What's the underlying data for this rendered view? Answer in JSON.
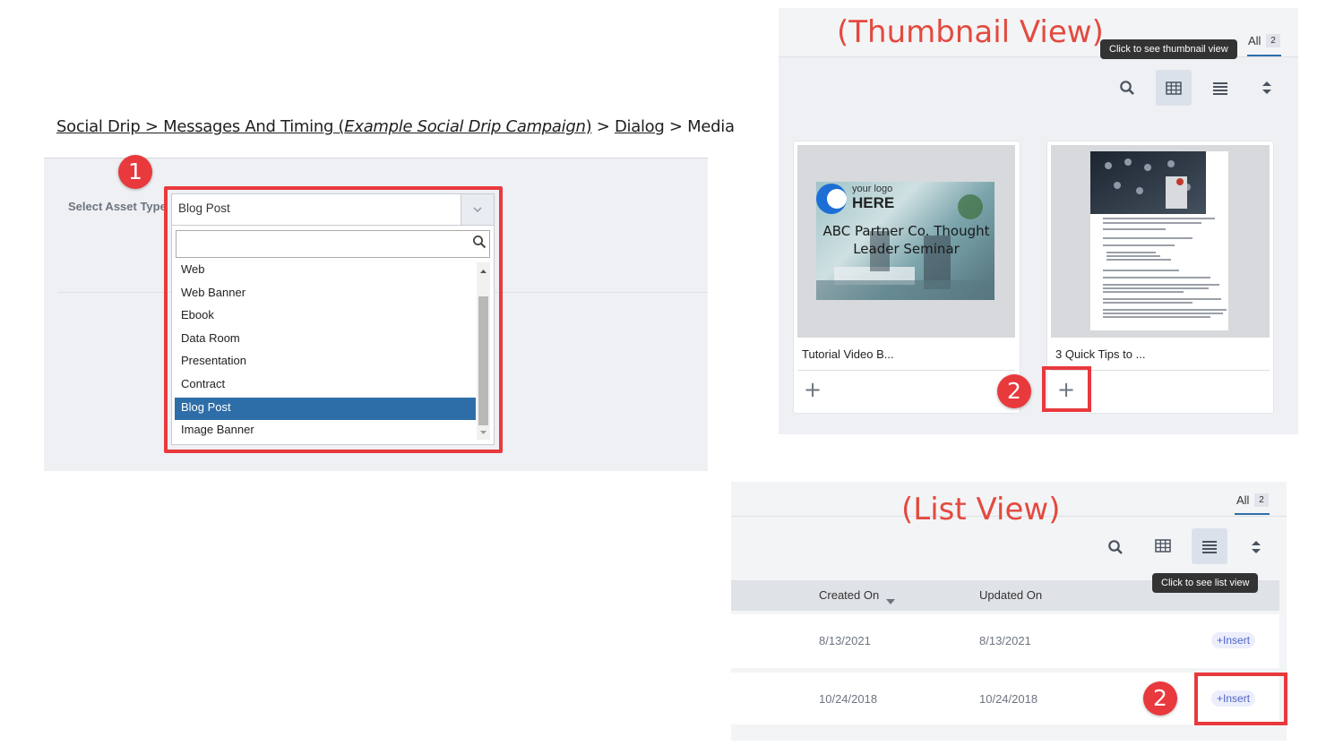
{
  "breadcrumb": {
    "social_drip": "Social Drip",
    "sep1": " > ",
    "messages": "Messages And Timing ",
    "paren_open": "(",
    "campaign": "Example Social Drip Campaign",
    "paren_close": ")",
    "sep2": " > ",
    "dialog": "Dialog",
    "sep3": " > ",
    "media": "Media"
  },
  "asset_select": {
    "label": "Select Asset Type",
    "value": "Blog Post",
    "options": [
      "Web",
      "Web Banner",
      "Ebook",
      "Data Room",
      "Presentation",
      "Contract",
      "Blog Post",
      "Image Banner"
    ]
  },
  "annotations": {
    "badge_1": "1",
    "badge_2": "2",
    "thumbnail_title": "(Thumbnail View)",
    "list_title": "(List View)"
  },
  "thumbnail_view": {
    "tab_label": "All",
    "tab_count": "2",
    "tooltip": "Click to see thumbnail view",
    "cards": [
      {
        "title": "Tutorial Video B...",
        "logo_text": "your logo",
        "logo_here": "HERE",
        "overlay": "ABC Partner Co. Thought Leader Seminar"
      },
      {
        "title": "3 Quick Tips to ..."
      }
    ],
    "add_symbol": "+"
  },
  "list_view": {
    "tab_label": "All",
    "tab_count": "2",
    "tooltip": "Click to see list view",
    "columns": [
      "Created On",
      "Updated On"
    ],
    "rows": [
      {
        "created": "8/13/2021",
        "updated": "8/13/2021",
        "action": "Insert"
      },
      {
        "created": "10/24/2018",
        "updated": "10/24/2018",
        "action": "Insert"
      }
    ]
  },
  "colors": {
    "accent_red": "#e8393d",
    "selected_blue": "#2e6ea8",
    "insert_purple": "#5064c8"
  },
  "icons": [
    "search-icon",
    "grid-icon",
    "list-icon",
    "sort-icon",
    "chevron-down-icon",
    "plus-icon"
  ]
}
